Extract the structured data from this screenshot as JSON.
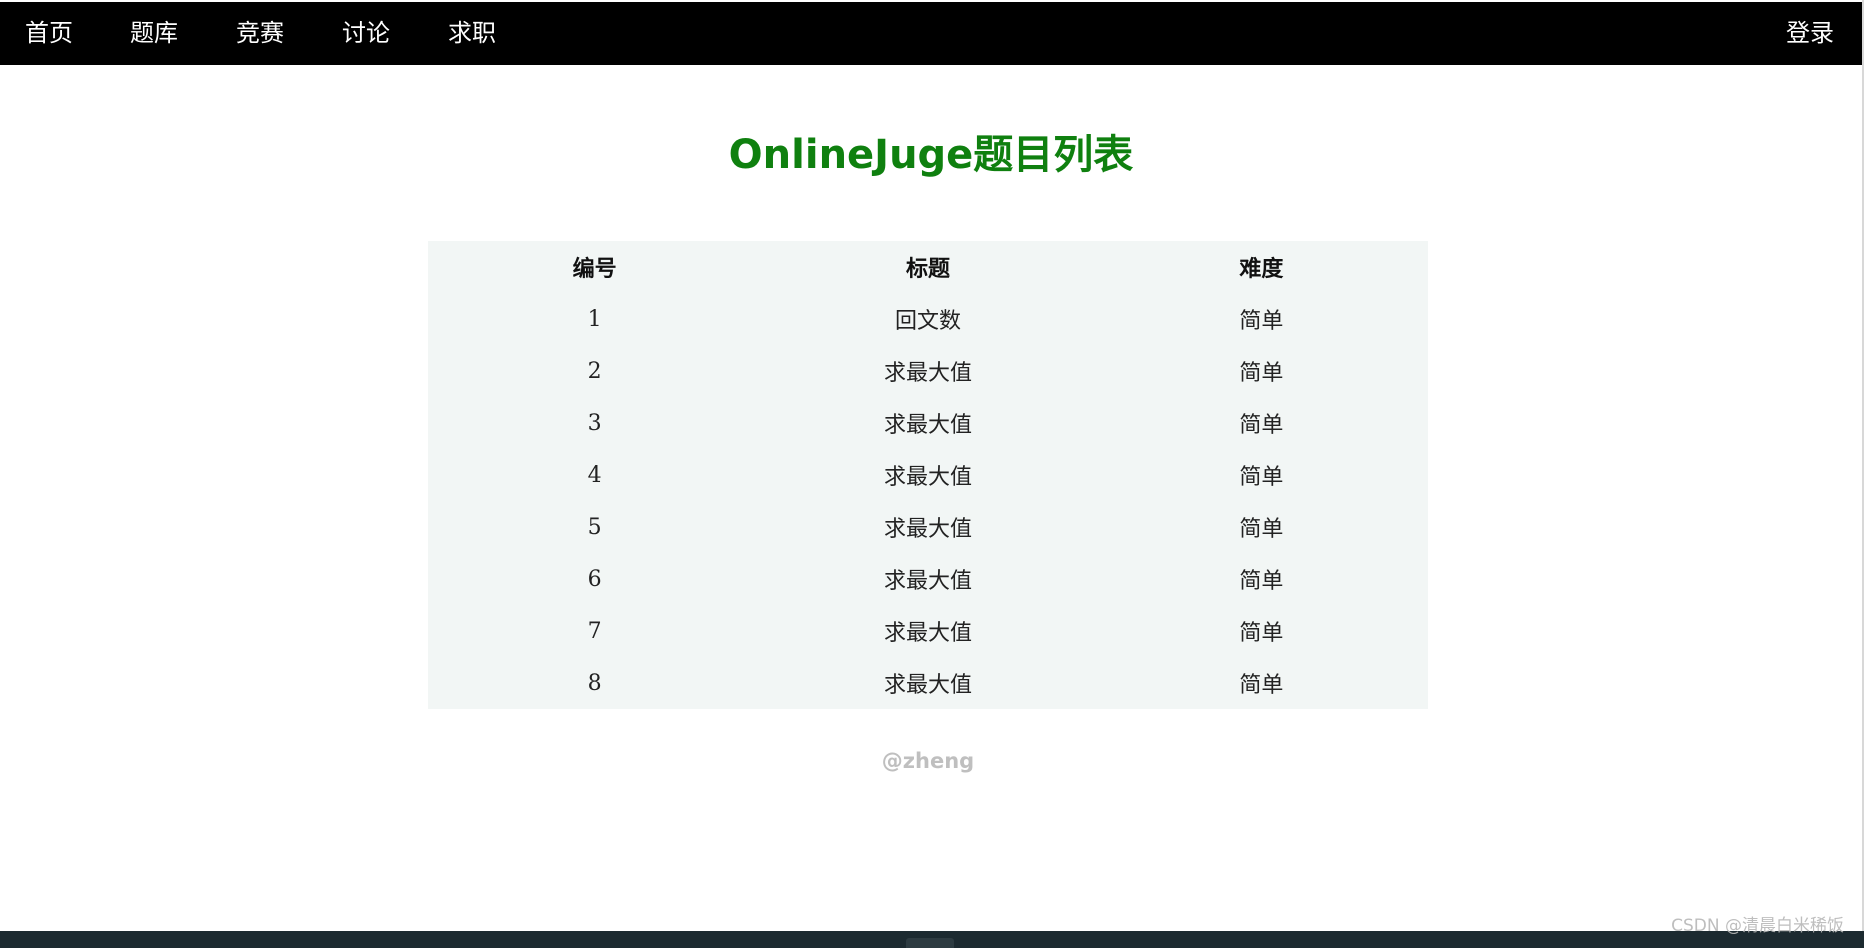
{
  "nav": {
    "home": "首页",
    "problems": "题库",
    "contest": "竞赛",
    "discuss": "讨论",
    "jobs": "求职",
    "login": "登录"
  },
  "page_title": "OnlineJuge题目列表",
  "table": {
    "headers": [
      "编号",
      "标题",
      "难度"
    ],
    "rows": [
      {
        "id": "1",
        "title": "回文数",
        "difficulty": "简单"
      },
      {
        "id": "2",
        "title": "求最大值",
        "difficulty": "简单"
      },
      {
        "id": "3",
        "title": "求最大值",
        "difficulty": "简单"
      },
      {
        "id": "4",
        "title": "求最大值",
        "difficulty": "简单"
      },
      {
        "id": "5",
        "title": "求最大值",
        "difficulty": "简单"
      },
      {
        "id": "6",
        "title": "求最大值",
        "difficulty": "简单"
      },
      {
        "id": "7",
        "title": "求最大值",
        "difficulty": "简单"
      },
      {
        "id": "8",
        "title": "求最大值",
        "difficulty": "简单"
      }
    ]
  },
  "author": "@zheng",
  "watermark": "CSDN @清晨白米稀饭",
  "colors": {
    "navbar_bg": "#000000",
    "nav_text": "#ffffff",
    "title": "#0f800f",
    "table_bg": "#f2f6f5",
    "author": "#bfbfbf"
  }
}
